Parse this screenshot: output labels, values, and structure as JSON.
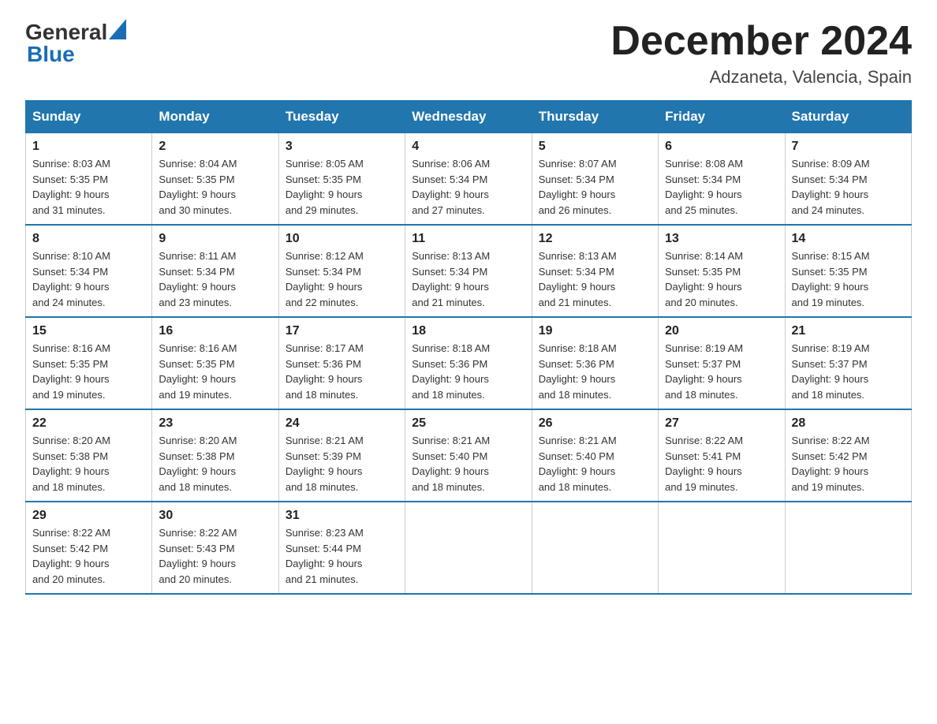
{
  "logo": {
    "general": "General",
    "blue": "Blue"
  },
  "title": "December 2024",
  "location": "Adzaneta, Valencia, Spain",
  "days_of_week": [
    "Sunday",
    "Monday",
    "Tuesday",
    "Wednesday",
    "Thursday",
    "Friday",
    "Saturday"
  ],
  "weeks": [
    [
      {
        "day": "1",
        "sunrise": "8:03 AM",
        "sunset": "5:35 PM",
        "daylight": "9 hours and 31 minutes."
      },
      {
        "day": "2",
        "sunrise": "8:04 AM",
        "sunset": "5:35 PM",
        "daylight": "9 hours and 30 minutes."
      },
      {
        "day": "3",
        "sunrise": "8:05 AM",
        "sunset": "5:35 PM",
        "daylight": "9 hours and 29 minutes."
      },
      {
        "day": "4",
        "sunrise": "8:06 AM",
        "sunset": "5:34 PM",
        "daylight": "9 hours and 27 minutes."
      },
      {
        "day": "5",
        "sunrise": "8:07 AM",
        "sunset": "5:34 PM",
        "daylight": "9 hours and 26 minutes."
      },
      {
        "day": "6",
        "sunrise": "8:08 AM",
        "sunset": "5:34 PM",
        "daylight": "9 hours and 25 minutes."
      },
      {
        "day": "7",
        "sunrise": "8:09 AM",
        "sunset": "5:34 PM",
        "daylight": "9 hours and 24 minutes."
      }
    ],
    [
      {
        "day": "8",
        "sunrise": "8:10 AM",
        "sunset": "5:34 PM",
        "daylight": "9 hours and 24 minutes."
      },
      {
        "day": "9",
        "sunrise": "8:11 AM",
        "sunset": "5:34 PM",
        "daylight": "9 hours and 23 minutes."
      },
      {
        "day": "10",
        "sunrise": "8:12 AM",
        "sunset": "5:34 PM",
        "daylight": "9 hours and 22 minutes."
      },
      {
        "day": "11",
        "sunrise": "8:13 AM",
        "sunset": "5:34 PM",
        "daylight": "9 hours and 21 minutes."
      },
      {
        "day": "12",
        "sunrise": "8:13 AM",
        "sunset": "5:34 PM",
        "daylight": "9 hours and 21 minutes."
      },
      {
        "day": "13",
        "sunrise": "8:14 AM",
        "sunset": "5:35 PM",
        "daylight": "9 hours and 20 minutes."
      },
      {
        "day": "14",
        "sunrise": "8:15 AM",
        "sunset": "5:35 PM",
        "daylight": "9 hours and 19 minutes."
      }
    ],
    [
      {
        "day": "15",
        "sunrise": "8:16 AM",
        "sunset": "5:35 PM",
        "daylight": "9 hours and 19 minutes."
      },
      {
        "day": "16",
        "sunrise": "8:16 AM",
        "sunset": "5:35 PM",
        "daylight": "9 hours and 19 minutes."
      },
      {
        "day": "17",
        "sunrise": "8:17 AM",
        "sunset": "5:36 PM",
        "daylight": "9 hours and 18 minutes."
      },
      {
        "day": "18",
        "sunrise": "8:18 AM",
        "sunset": "5:36 PM",
        "daylight": "9 hours and 18 minutes."
      },
      {
        "day": "19",
        "sunrise": "8:18 AM",
        "sunset": "5:36 PM",
        "daylight": "9 hours and 18 minutes."
      },
      {
        "day": "20",
        "sunrise": "8:19 AM",
        "sunset": "5:37 PM",
        "daylight": "9 hours and 18 minutes."
      },
      {
        "day": "21",
        "sunrise": "8:19 AM",
        "sunset": "5:37 PM",
        "daylight": "9 hours and 18 minutes."
      }
    ],
    [
      {
        "day": "22",
        "sunrise": "8:20 AM",
        "sunset": "5:38 PM",
        "daylight": "9 hours and 18 minutes."
      },
      {
        "day": "23",
        "sunrise": "8:20 AM",
        "sunset": "5:38 PM",
        "daylight": "9 hours and 18 minutes."
      },
      {
        "day": "24",
        "sunrise": "8:21 AM",
        "sunset": "5:39 PM",
        "daylight": "9 hours and 18 minutes."
      },
      {
        "day": "25",
        "sunrise": "8:21 AM",
        "sunset": "5:40 PM",
        "daylight": "9 hours and 18 minutes."
      },
      {
        "day": "26",
        "sunrise": "8:21 AM",
        "sunset": "5:40 PM",
        "daylight": "9 hours and 18 minutes."
      },
      {
        "day": "27",
        "sunrise": "8:22 AM",
        "sunset": "5:41 PM",
        "daylight": "9 hours and 19 minutes."
      },
      {
        "day": "28",
        "sunrise": "8:22 AM",
        "sunset": "5:42 PM",
        "daylight": "9 hours and 19 minutes."
      }
    ],
    [
      {
        "day": "29",
        "sunrise": "8:22 AM",
        "sunset": "5:42 PM",
        "daylight": "9 hours and 20 minutes."
      },
      {
        "day": "30",
        "sunrise": "8:22 AM",
        "sunset": "5:43 PM",
        "daylight": "9 hours and 20 minutes."
      },
      {
        "day": "31",
        "sunrise": "8:23 AM",
        "sunset": "5:44 PM",
        "daylight": "9 hours and 21 minutes."
      },
      null,
      null,
      null,
      null
    ]
  ],
  "labels": {
    "sunrise": "Sunrise:",
    "sunset": "Sunset:",
    "daylight": "Daylight:"
  }
}
